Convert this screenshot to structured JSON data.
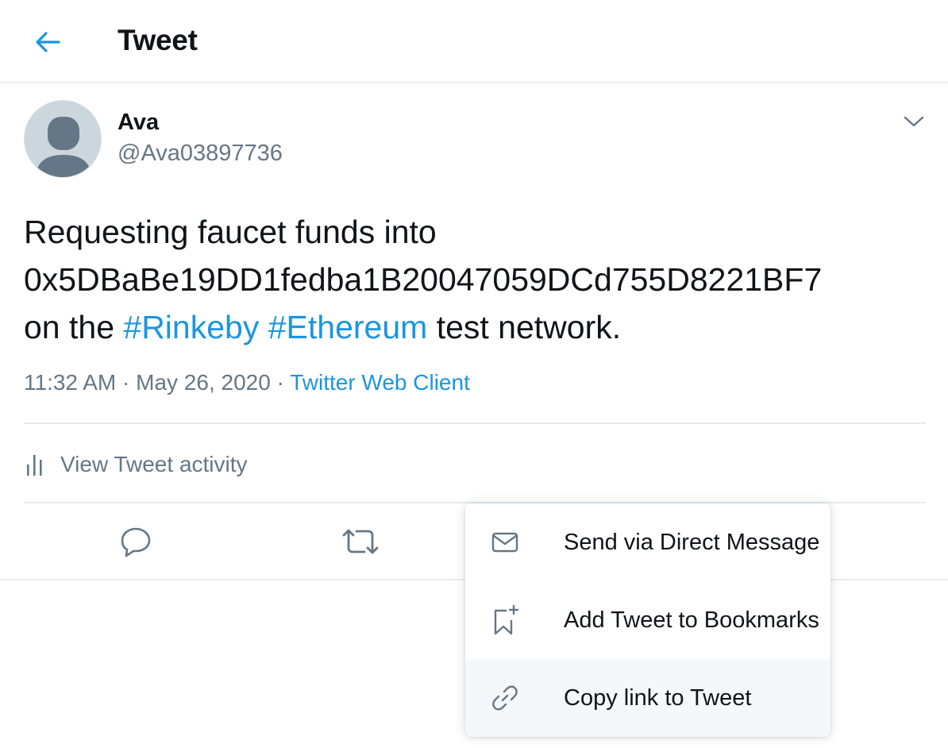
{
  "header": {
    "title": "Tweet"
  },
  "tweet": {
    "author_name": "Ava",
    "author_handle": "@Ava03897736",
    "text_line1": "Requesting faucet funds into",
    "text_line2": "0x5DBaBe19DD1fedba1B20047059DCd755D8221BF7",
    "text_line3_prefix": "on the ",
    "hashtag1": "#Rinkeby",
    "text_space": " ",
    "hashtag2": "#Ethereum",
    "text_line3_suffix": " test network.",
    "time": "11:32 AM",
    "separator": " · ",
    "date": "May 26, 2020",
    "source": "Twitter Web Client"
  },
  "activity": {
    "label": "View Tweet activity"
  },
  "share_menu": {
    "items": [
      {
        "label": "Send via Direct Message",
        "icon": "envelope-icon"
      },
      {
        "label": "Add Tweet to Bookmarks",
        "icon": "bookmark-add-icon"
      },
      {
        "label": "Copy link to Tweet",
        "icon": "link-icon"
      }
    ]
  },
  "colors": {
    "accent": "#1b95e0",
    "secondary_text": "#657786",
    "border": "#e6ecf0",
    "hover_bg": "#f5f8fa"
  }
}
